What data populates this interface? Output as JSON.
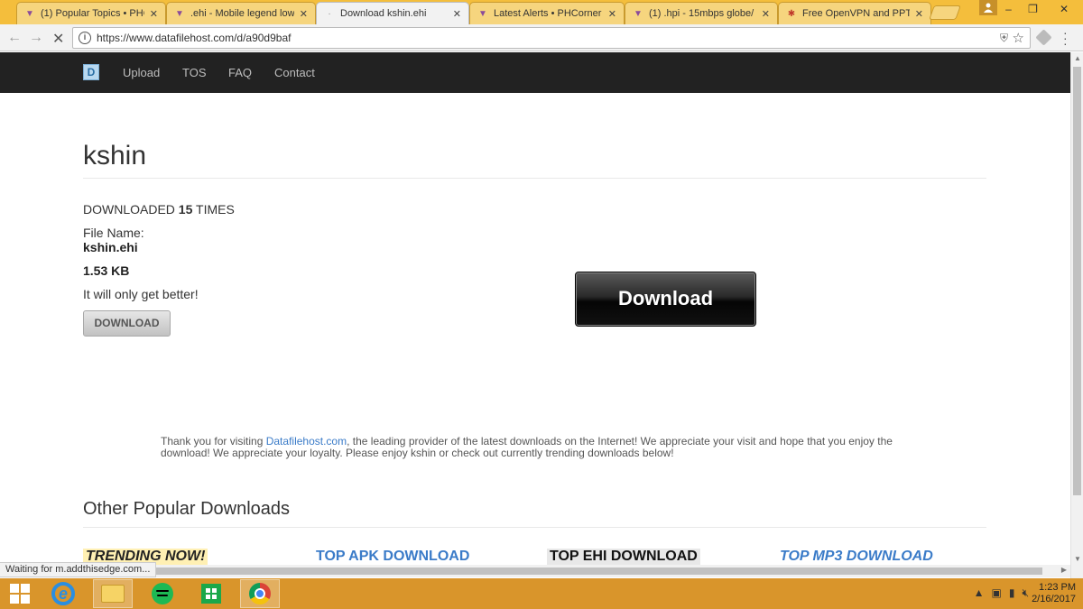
{
  "browser": {
    "tabs": [
      {
        "title": "(1) Popular Topics • PHC",
        "icon": "phcorner-favicon"
      },
      {
        "title": ".ehi - Mobile legend low",
        "icon": "phcorner-favicon"
      },
      {
        "title": "Download kshin.ehi",
        "icon": "loading-favicon",
        "active": true
      },
      {
        "title": "Latest Alerts • PHCorner",
        "icon": "phcorner-favicon"
      },
      {
        "title": "(1) .hpi - 15mbps globe/",
        "icon": "phcorner-favicon"
      },
      {
        "title": "Free OpenVPN and PPTP",
        "icon": "vpn-favicon"
      }
    ],
    "url": "https://www.datafilehost.com/d/a90d9baf"
  },
  "site": {
    "logo_letter": "D",
    "nav": [
      "Upload",
      "TOS",
      "FAQ",
      "Contact"
    ]
  },
  "file": {
    "title": "kshin",
    "downloaded_prefix": "DOWNLOADED ",
    "downloaded_count": "15",
    "downloaded_suffix": " TIMES",
    "file_name_label": "File Name:",
    "file_name": "kshin.ehi",
    "size": "1.53 KB",
    "tagline": "It will only get better!",
    "small_download_label": "DOWNLOAD",
    "big_download_label": "Download"
  },
  "thanks": {
    "prefix": "Thank you for visiting ",
    "link": "Datafilehost.com",
    "suffix": ", the leading provider of the latest downloads on the Internet! We appreciate your visit and hope that you enjoy the download! We appreciate your loyalty. Please enjoy kshin or check out currently trending downloads below!"
  },
  "popular": {
    "title": "Other Popular Downloads",
    "categories": [
      "TRENDING NOW!",
      "TOP APK DOWNLOAD",
      "TOP EHI DOWNLOAD",
      "TOP MP3 DOWNLOAD"
    ]
  },
  "status_text": "Waiting for m.addthisedge.com...",
  "taskbar": {
    "apps": [
      "start-button",
      "internet-explorer",
      "file-explorer",
      "spotify",
      "windows-store",
      "chrome"
    ],
    "time": "1:23 PM",
    "date": "2/16/2017"
  }
}
